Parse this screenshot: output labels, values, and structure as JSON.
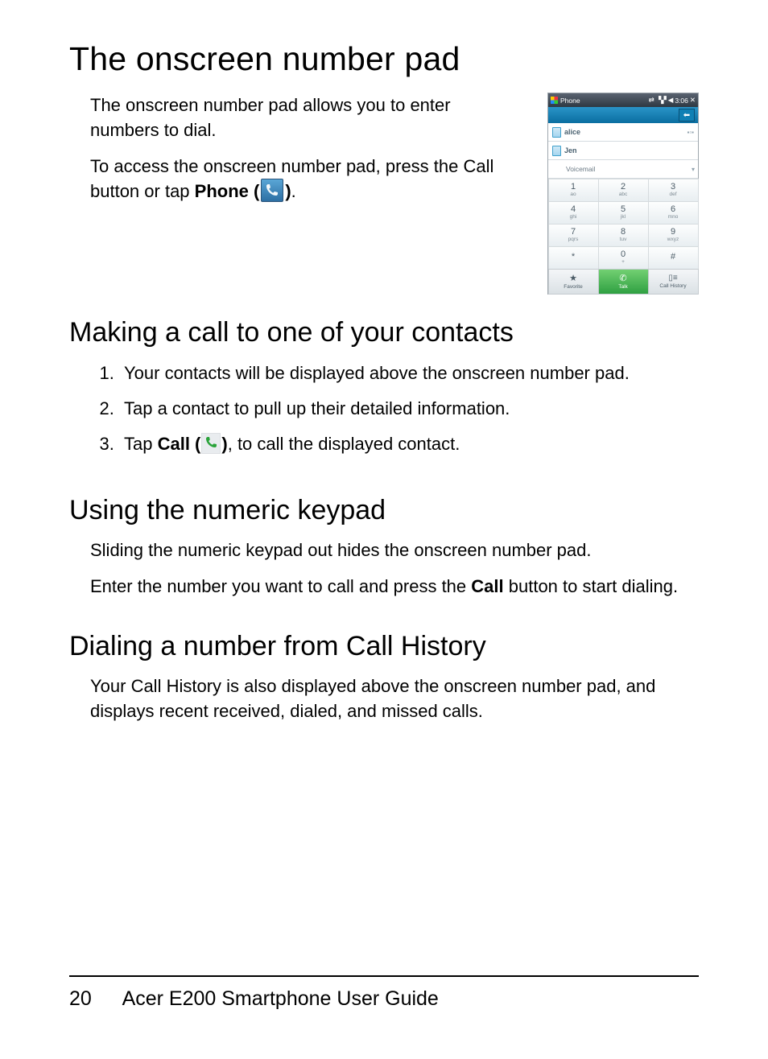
{
  "title": "The onscreen number pad",
  "intro_p1": "The onscreen number pad allows you to enter numbers to dial.",
  "intro_p2_a": "To access the onscreen number pad, press the Call button or tap ",
  "intro_p2_bold": "Phone (",
  "intro_p2_close": ")",
  "intro_p2_period": ".",
  "h2_contacts": "Making a call to one of your contacts",
  "steps": {
    "1": "Your contacts will be displayed above the onscreen number pad.",
    "2": "Tap a contact to pull up their detailed information.",
    "3a": "Tap ",
    "3b_bold": "Call (",
    "3b_close": ")",
    "3c": ", to call the displayed contact."
  },
  "h2_keypad": "Using the numeric keypad",
  "keypad_p1": "Sliding the numeric keypad out hides the onscreen number pad.",
  "keypad_p2_a": "Enter the number you want to call and press the ",
  "keypad_p2_bold": "Call",
  "keypad_p2_b": " button to start dialing.",
  "h2_history": "Dialing a number from Call History",
  "history_p1": "Your Call History is also displayed above the onscreen number pad, and displays recent received, dialed, and missed calls.",
  "footer": {
    "page": "20",
    "title": "Acer E200 Smartphone User Guide"
  },
  "device": {
    "sys_title": "Phone",
    "sys_time": "3:06",
    "contacts": {
      "0": "alice",
      "1": "Jen",
      "2": "Voicemail"
    },
    "keys": [
      {
        "n": "1",
        "s": "ao"
      },
      {
        "n": "2",
        "s": "abc"
      },
      {
        "n": "3",
        "s": "def"
      },
      {
        "n": "4",
        "s": "ghi"
      },
      {
        "n": "5",
        "s": "jkl"
      },
      {
        "n": "6",
        "s": "mno"
      },
      {
        "n": "7",
        "s": "pqrs"
      },
      {
        "n": "8",
        "s": "tuv"
      },
      {
        "n": "9",
        "s": "wxyz"
      },
      {
        "n": "*",
        "s": ""
      },
      {
        "n": "0",
        "s": "+"
      },
      {
        "n": "#",
        "s": ""
      }
    ],
    "dock": {
      "fav": "Favorite",
      "talk": "Talk",
      "hist": "Call History"
    }
  }
}
